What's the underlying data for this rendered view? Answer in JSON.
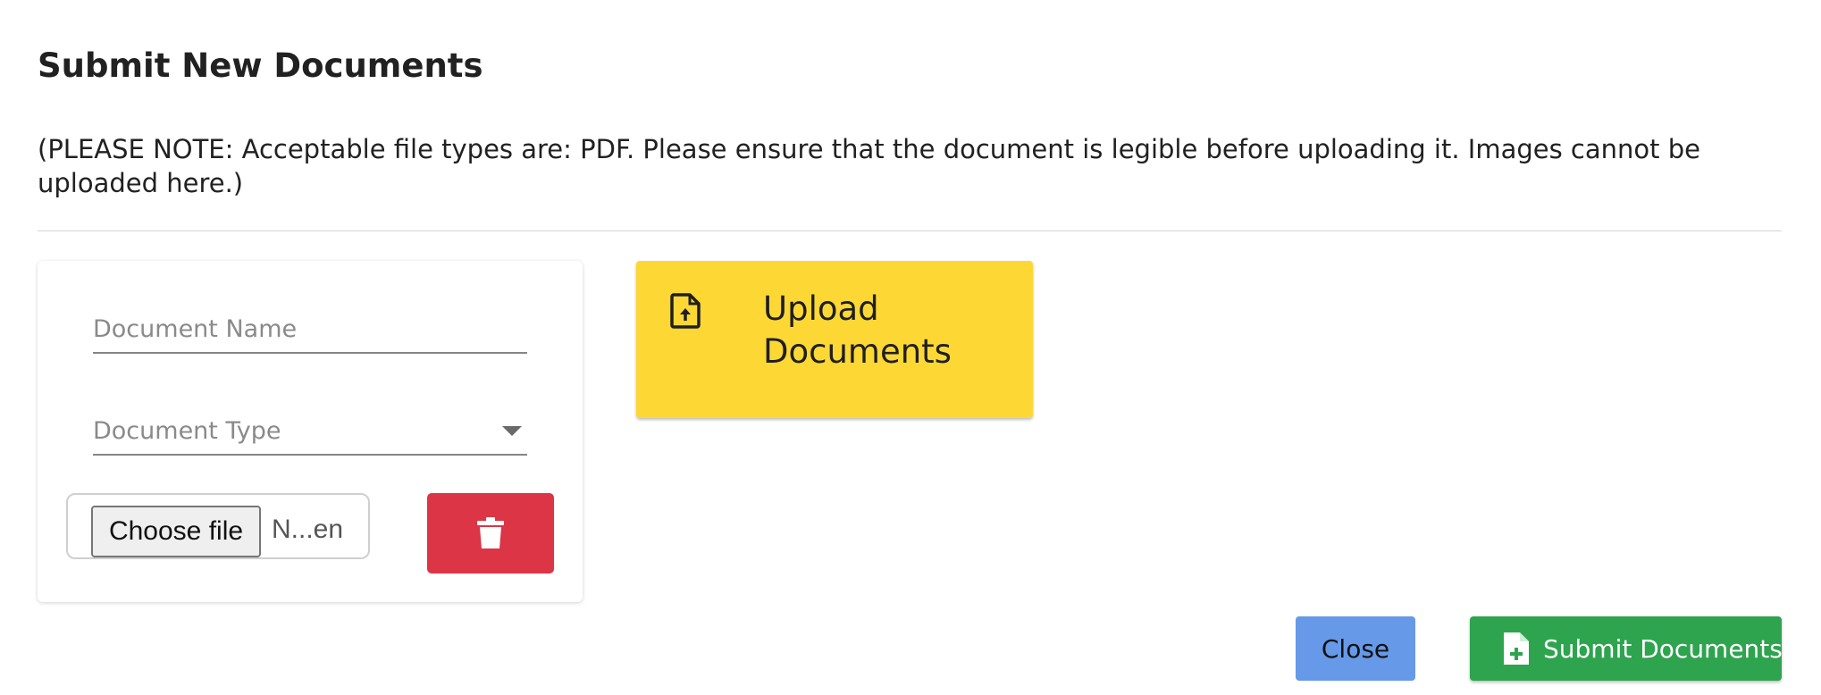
{
  "dialog": {
    "title": "Submit New Documents",
    "note": "(PLEASE NOTE: Acceptable file types are: PDF. Please ensure that the document is legible before uploading it. Images cannot be uploaded here.)"
  },
  "document_form": {
    "name_field": {
      "placeholder": "Document Name",
      "value": ""
    },
    "type_select": {
      "placeholder": "Document Type",
      "value": "",
      "icon": "chevron-down-icon"
    },
    "file_input": {
      "button_label": "Choose file",
      "status_text": "N...en"
    },
    "delete_button": {
      "icon": "trash-icon",
      "color": "#dc3545"
    }
  },
  "upload_button": {
    "label": "Upload Documents",
    "icon": "file-upload-icon",
    "color": "#fdd835"
  },
  "footer": {
    "close_label": "Close",
    "close_color": "#6699e8",
    "submit_label": "Submit Documents",
    "submit_icon": "file-plus-icon",
    "submit_color": "#2ea44f"
  }
}
